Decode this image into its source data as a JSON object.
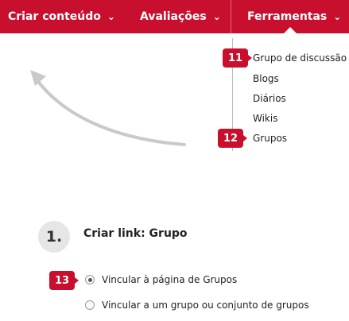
{
  "menubar": {
    "items": [
      {
        "label": "Criar conteúdo",
        "chevron": "⌄"
      },
      {
        "label": "Avaliações",
        "chevron": "⌄"
      },
      {
        "label": "Ferramentas",
        "chevron": "⌄"
      }
    ]
  },
  "submenu": {
    "items": [
      "Grupo de discussão",
      "Blogs",
      "Diários",
      "Wikis",
      "Grupos"
    ]
  },
  "badges": [
    "11",
    "12",
    "13"
  ],
  "step": {
    "number": "1.",
    "title": "Criar link: Grupo"
  },
  "options": [
    {
      "label": "Vincular à página de Grupos",
      "selected": true
    },
    {
      "label": "Vincular a um grupo ou conjunto de grupos",
      "selected": false
    }
  ],
  "colors": {
    "brand": "#c8102e",
    "arrow": "#c9c9c9"
  }
}
